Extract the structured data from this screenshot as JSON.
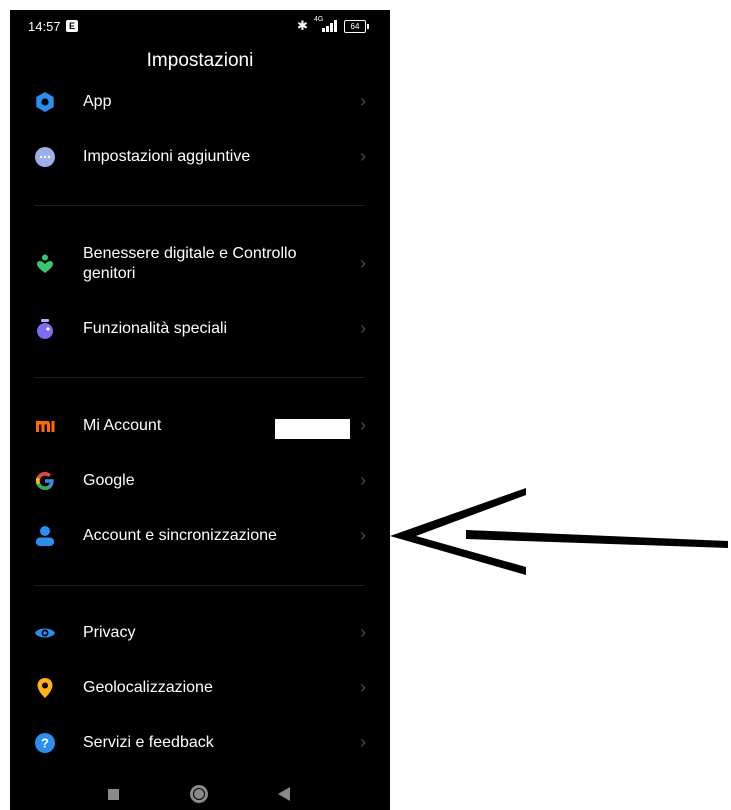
{
  "status_bar": {
    "time": "14:57",
    "notification_badge": "E",
    "network": "4G",
    "battery": "64"
  },
  "header": {
    "title": "Impostazioni"
  },
  "colors": {
    "background": "#000000",
    "chevron": "#4a4a4a"
  },
  "menu": [
    {
      "label": "App",
      "icon": "gear-icon",
      "color": "#2b8ff0"
    },
    {
      "label": "Impostazioni aggiuntive",
      "icon": "more-dots-icon",
      "color": "#9bb0ea"
    },
    {
      "label": "Benessere digitale e Controllo genitori",
      "icon": "wellbeing-icon",
      "color": "#3ac76f"
    },
    {
      "label": "Funzionalità speciali",
      "icon": "special-features-icon",
      "color": "#7d6cf0"
    },
    {
      "label": "Mi Account",
      "icon": "mi-logo-icon",
      "color": "#ff6a00"
    },
    {
      "label": "Google",
      "icon": "google-icon",
      "color": "#4285f4"
    },
    {
      "label": "Account e sincronizzazione",
      "icon": "person-icon",
      "color": "#2b8ff0"
    },
    {
      "label": "Privacy",
      "icon": "eye-icon",
      "color": "#2b8ff0"
    },
    {
      "label": "Geolocalizzazione",
      "icon": "location-pin-icon",
      "color": "#ffb020"
    },
    {
      "label": "Servizi e feedback",
      "icon": "help-icon",
      "color": "#2b8ff0"
    }
  ],
  "nav_bar": {
    "icons": [
      "recents-icon",
      "home-icon",
      "back-icon"
    ]
  },
  "annotation": {
    "icon": "hand-drawn-arrow-icon",
    "points_to": "Account e sincronizzazione"
  }
}
